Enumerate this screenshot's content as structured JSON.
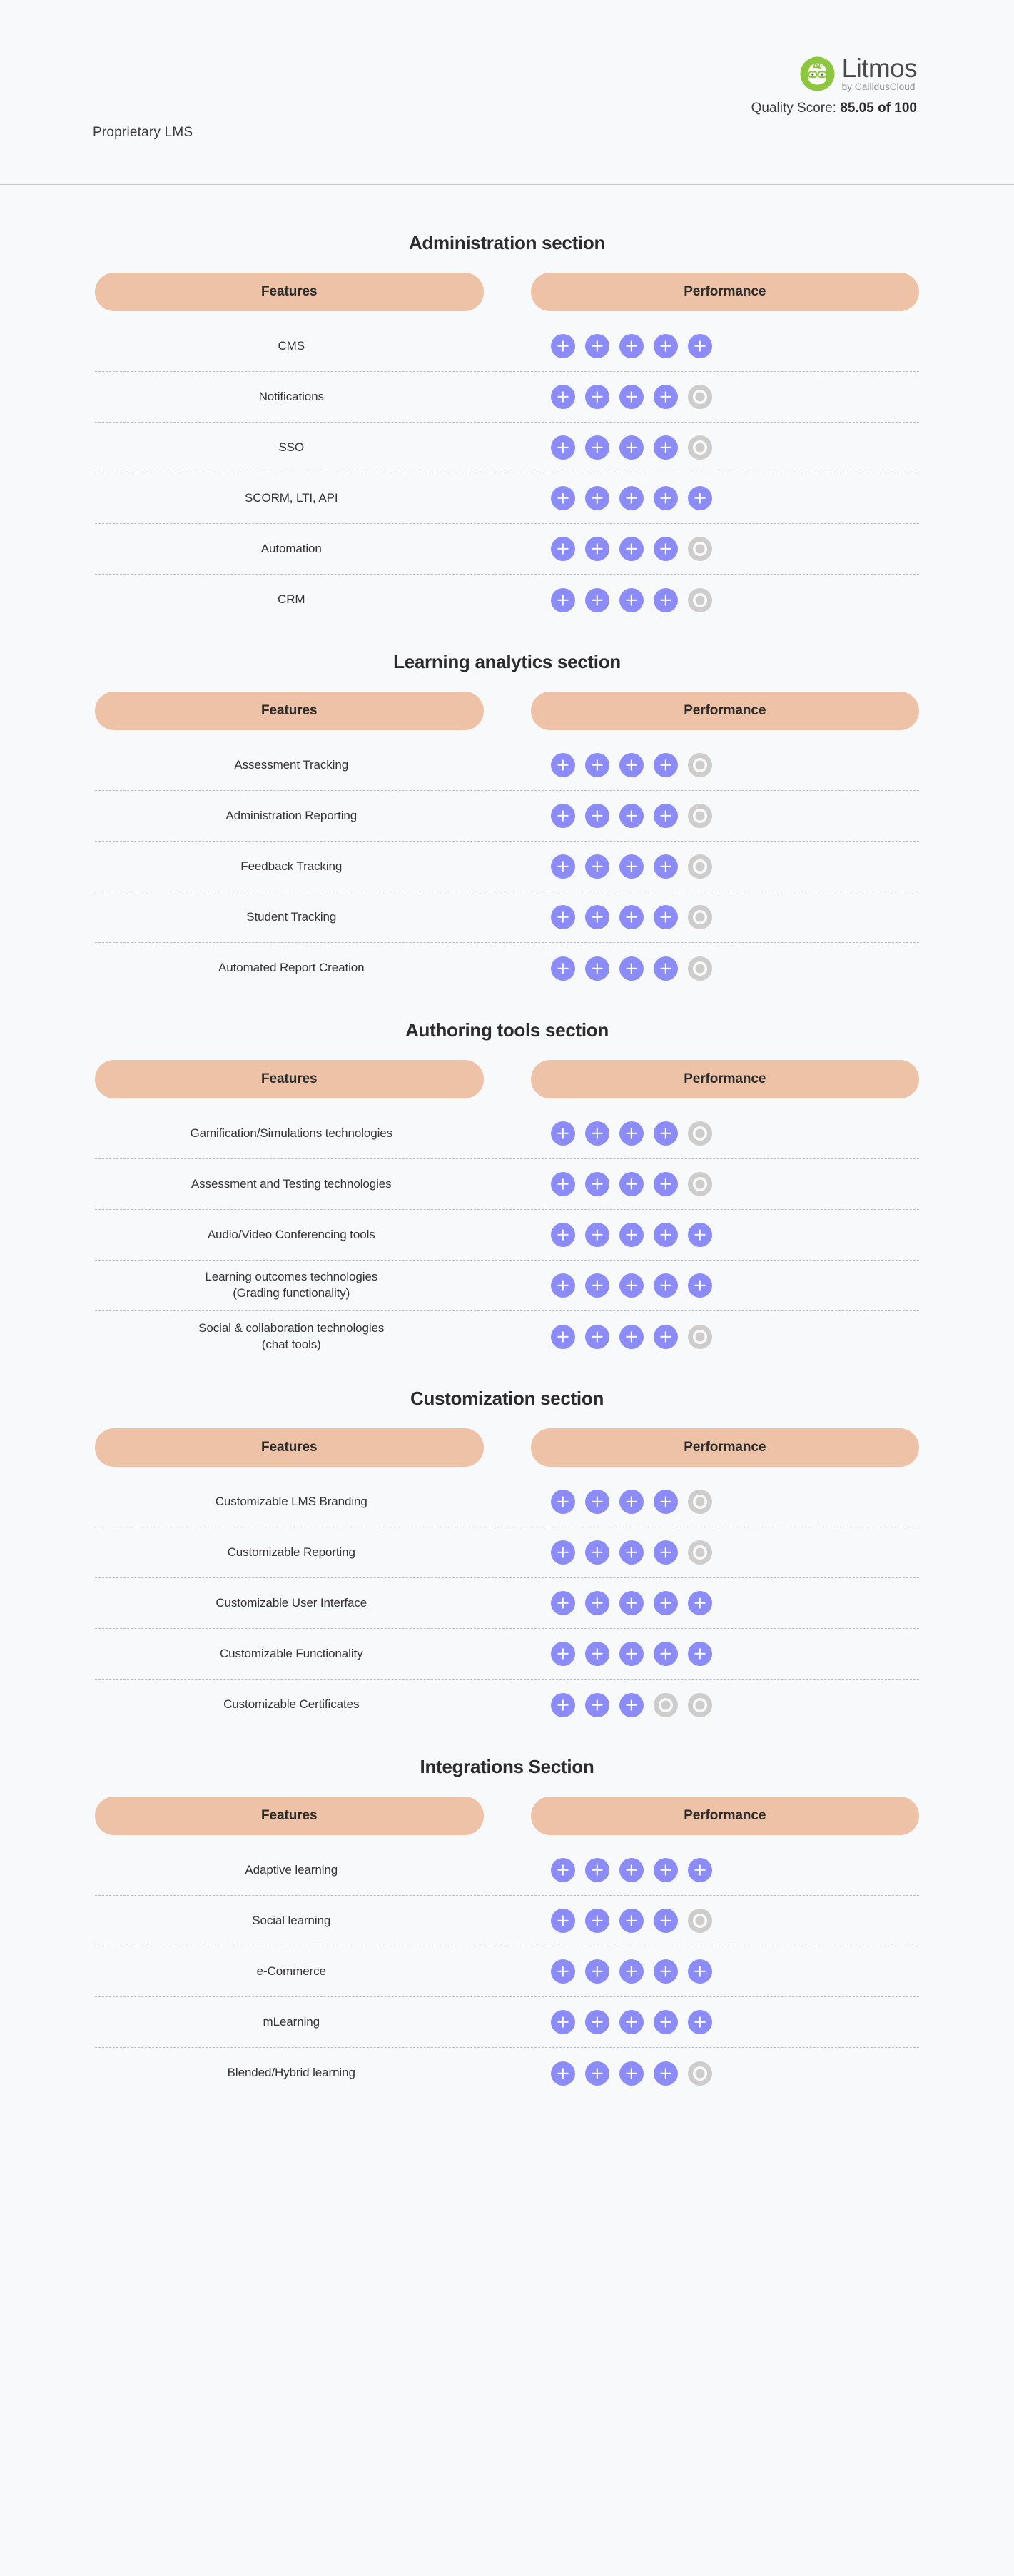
{
  "header": {
    "left_label": "Proprietary LMS",
    "brand_name": "Litmos",
    "brand_sub": "by CallidusCloud",
    "brand_logo_icon": "litmos-nerd-face-logo",
    "brand_color": "#8DC63F",
    "quality_prefix": "Quality Score:",
    "quality_value": "85.05 of 100"
  },
  "table_headers": {
    "features": "Features",
    "performance": "Performance"
  },
  "rating": {
    "max": 5,
    "filled_color": "#8b8cf7",
    "empty_color": "#cfcdcb",
    "filled_icon": "plus-circle-icon",
    "empty_icon": "empty-circle-icon"
  },
  "colors": {
    "page_background": "#f8f9fa",
    "header_pill": "#edc2a6",
    "title_text": "#2b2b2b",
    "row_divider": "#b9b9b9"
  },
  "sections": [
    {
      "title": "Administration section",
      "rows": [
        {
          "feature": "CMS",
          "score": 5
        },
        {
          "feature": "Notifications",
          "score": 4
        },
        {
          "feature": "SSO",
          "score": 4
        },
        {
          "feature": "SCORM, LTI, API",
          "score": 5
        },
        {
          "feature": "Automation",
          "score": 4
        },
        {
          "feature": "CRM",
          "score": 4
        }
      ]
    },
    {
      "title": "Learning analytics section",
      "rows": [
        {
          "feature": "Assessment Tracking",
          "score": 4
        },
        {
          "feature": "Administration Reporting",
          "score": 4
        },
        {
          "feature": "Feedback Tracking",
          "score": 4
        },
        {
          "feature": "Student Tracking",
          "score": 4
        },
        {
          "feature": "Automated Report Creation",
          "score": 4
        }
      ]
    },
    {
      "title": "Authoring tools section",
      "rows": [
        {
          "feature": "Gamification/Simulations technologies",
          "score": 4
        },
        {
          "feature": "Assessment and Testing technologies",
          "score": 4
        },
        {
          "feature": "Audio/Video Conferencing tools",
          "score": 5
        },
        {
          "feature": "Learning outcomes technologies\n(Grading functionality)",
          "score": 5
        },
        {
          "feature": "Social & collaboration technologies\n(chat tools)",
          "score": 4
        }
      ]
    },
    {
      "title": "Customization section",
      "rows": [
        {
          "feature": "Customizable LMS Branding",
          "score": 4
        },
        {
          "feature": "Customizable Reporting",
          "score": 4
        },
        {
          "feature": "Customizable User Interface",
          "score": 5
        },
        {
          "feature": "Customizable Functionality",
          "score": 5
        },
        {
          "feature": "Customizable Certificates",
          "score": 3
        }
      ]
    },
    {
      "title": "Integrations Section",
      "rows": [
        {
          "feature": "Adaptive learning",
          "score": 5
        },
        {
          "feature": "Social learning",
          "score": 4
        },
        {
          "feature": "e-Commerce",
          "score": 5
        },
        {
          "feature": "mLearning",
          "score": 5
        },
        {
          "feature": "Blended/Hybrid learning",
          "score": 4
        }
      ]
    }
  ]
}
